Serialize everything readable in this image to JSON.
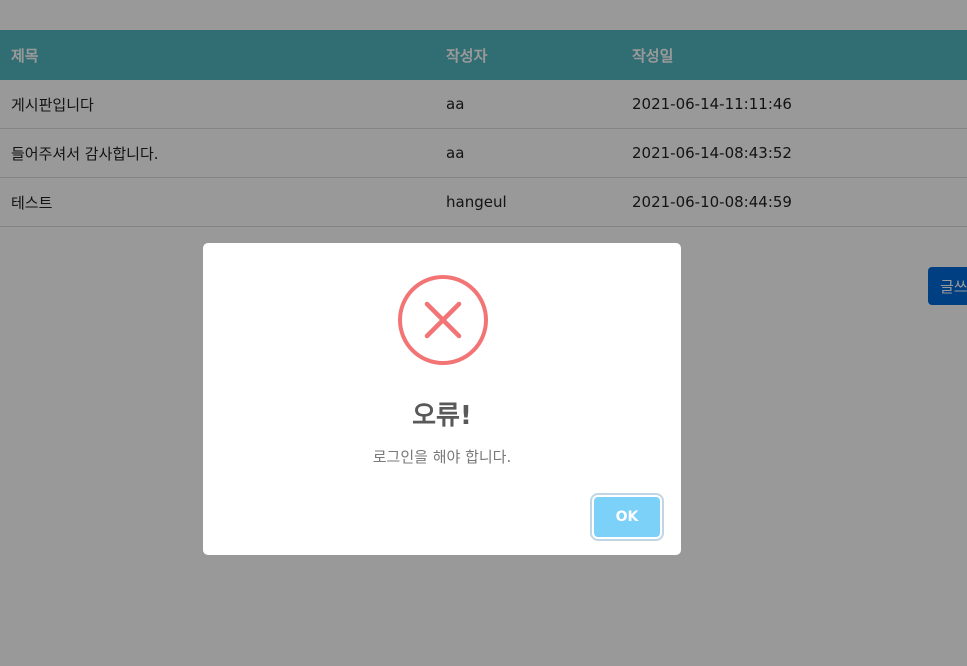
{
  "board": {
    "headers": [
      "제목",
      "작성자",
      "작성일"
    ],
    "rows": [
      {
        "title": "게시판입니다",
        "author": "aa",
        "date": "2021-06-14-11:11:46"
      },
      {
        "title": "들어주셔서 감사합니다.",
        "author": "aa",
        "date": "2021-06-14-08:43:52"
      },
      {
        "title": "테스트",
        "author": "hangeul",
        "date": "2021-06-10-08:44:59"
      }
    ],
    "write_button_label": "글쓰기"
  },
  "alert": {
    "icon": "error-x-icon",
    "title": "오류!",
    "message": "로그인을 해야 합니다.",
    "ok_label": "OK"
  },
  "colors": {
    "header_bg": "#50b7c1",
    "write_button": "#0069d9",
    "error_icon": "#f27474",
    "ok_button": "#7cd1f9"
  }
}
